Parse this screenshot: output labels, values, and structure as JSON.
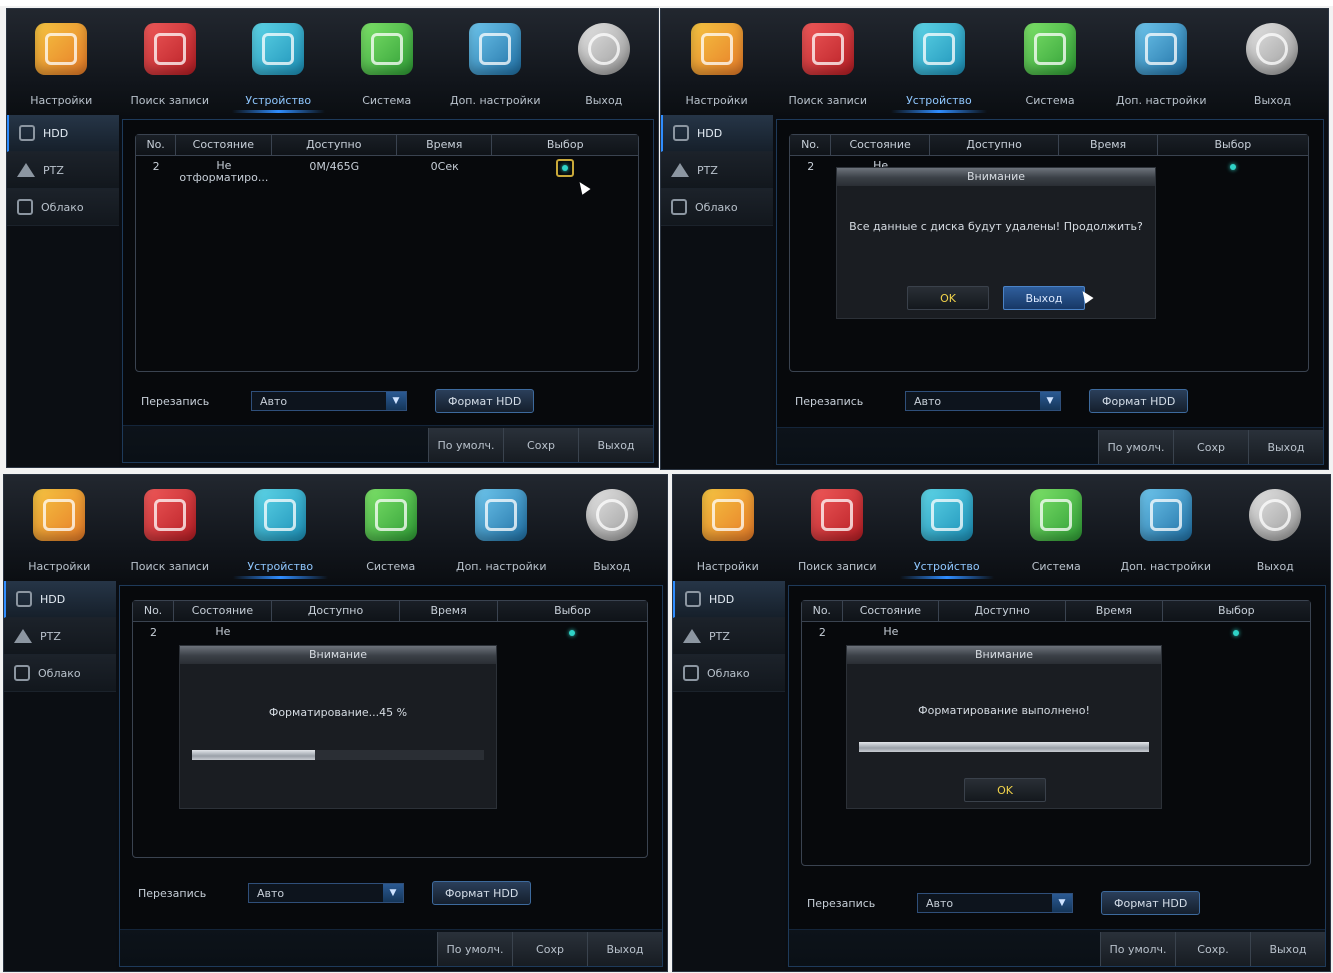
{
  "nav": [
    {
      "label": "Настройки",
      "icon": "settings-icon"
    },
    {
      "label": "Поиск записи",
      "icon": "record-search-icon"
    },
    {
      "label": "Устройство",
      "icon": "device-storage-icon"
    },
    {
      "label": "Система",
      "icon": "system-info-icon"
    },
    {
      "label": "Доп. настройки",
      "icon": "advanced-settings-icon"
    },
    {
      "label": "Выход",
      "icon": "power-icon"
    }
  ],
  "active_nav": "Устройство",
  "sidebar": [
    {
      "label": "HDD",
      "icon": "hdd-icon"
    },
    {
      "label": "PTZ",
      "icon": "ptz-camera-icon"
    },
    {
      "label": "Облако",
      "icon": "cloud-icon"
    }
  ],
  "table": {
    "headers": [
      "No.",
      "Состояние",
      "Доступно",
      "Время",
      "Выбор"
    ],
    "row": {
      "no": "2",
      "state_line1": "Не",
      "state_line2": "отформатиро...",
      "free": "0M/465G",
      "time": "0Сек"
    }
  },
  "overwrite": {
    "label": "Перезапись",
    "value": "Авто",
    "format_button": "Формат HDD"
  },
  "bottom_buttons": [
    "По умолч.",
    "Сохр",
    "Выход"
  ],
  "bottom_buttons_panel4": [
    "По умолч.",
    "Сохр.",
    "Выход"
  ],
  "dialogs": {
    "title": "Внимание",
    "confirm_message": "Все данные с диска будут удалены!  Продолжить?",
    "ok_label": "OK",
    "exit_label": "Выход",
    "progress_message": "Форматирование...45 %",
    "progress_value": 0.42,
    "done_message": "Форматирование выполнено!",
    "done_progress_value": 1.0
  },
  "colors": {
    "accent": "#2f8dff",
    "select_dot": "#2fd3c7",
    "ok_text": "#f0d24a"
  }
}
